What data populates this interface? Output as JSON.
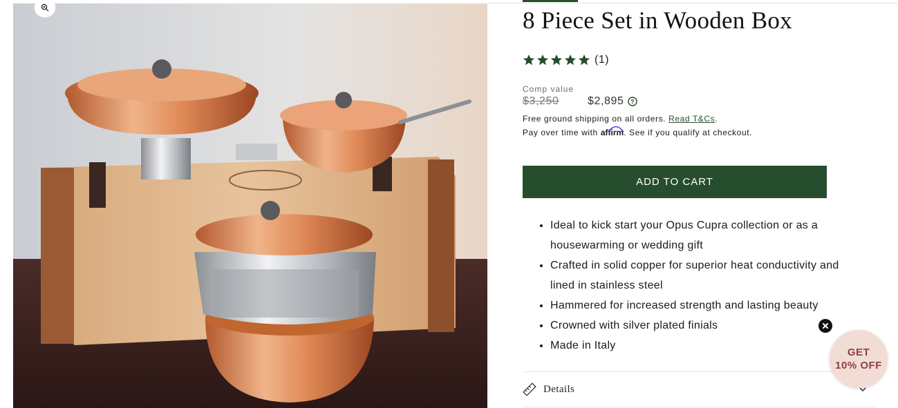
{
  "product": {
    "title": "8 Piece Set in Wooden Box",
    "rating_stars": 5,
    "review_count": "(1)",
    "comp_label": "Comp value",
    "old_price": "$3,250",
    "price": "$2,895"
  },
  "shipping": {
    "text": "Free ground shipping on all orders.",
    "link": "Read T&Cs",
    "suffix": "."
  },
  "financing": {
    "prefix": "Pay over time with",
    "brand": "affirm",
    "suffix": ". See if you qualify at checkout."
  },
  "cart": {
    "label": "ADD TO CART"
  },
  "features": [
    "Ideal to kick start your Opus Cupra collection or as a housewarming or wedding gift",
    "Crafted in solid copper for superior heat conductivity and lined in stainless steel",
    "Hammered for increased strength and lasting beauty",
    "Crowned with silver plated finials",
    "Made in Italy"
  ],
  "details": {
    "label": "Details"
  },
  "promo": {
    "line1": "GET",
    "line2": "10% OFF"
  },
  "colors": {
    "accent": "#264d2e",
    "promo_bg": "#f2ddd6",
    "promo_text": "#8e3f3f"
  }
}
